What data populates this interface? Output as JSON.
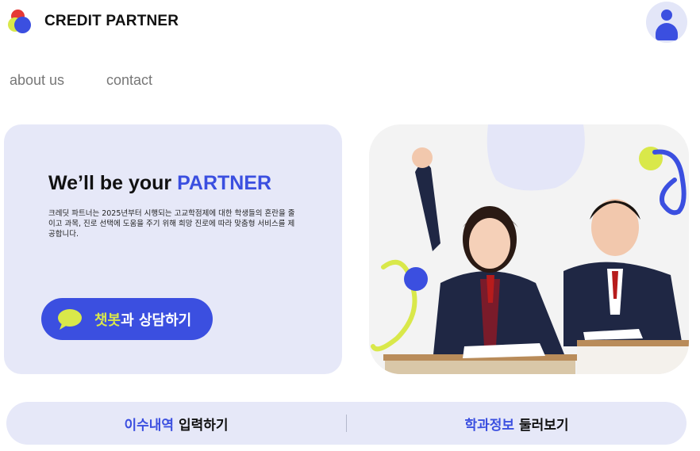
{
  "header": {
    "brand": "CREDIT PARTNER",
    "logo_icon": "logo-circles-icon",
    "avatar_icon": "user-icon"
  },
  "nav": {
    "about": "about us",
    "contact": "contact"
  },
  "hero": {
    "title_prefix": "We’ll be your ",
    "title_accent": "PARTNER",
    "description": "크레딧 파트너는 2025년부터 시행되는 고교학점제에 대한 학생들의 혼란을 줄이고 과목, 진로 선택에 도움을 주기 위해 희망 진로에 따라 맞춤형 서비스를 제공합니다.",
    "chat_button": {
      "highlight": "챗봇",
      "rest": "과 상담하기",
      "icon": "chat-bubble-icon"
    }
  },
  "photo": {
    "alt": "students-photo"
  },
  "bottom_bar": {
    "left": {
      "highlight": "이수내역",
      "rest": "입력하기"
    },
    "right": {
      "highlight": "학과정보",
      "rest": "둘러보기"
    }
  },
  "colors": {
    "accent": "#3b4fe0",
    "lime": "#d9e84a",
    "panel": "#e6e8f8",
    "red": "#e53935"
  }
}
